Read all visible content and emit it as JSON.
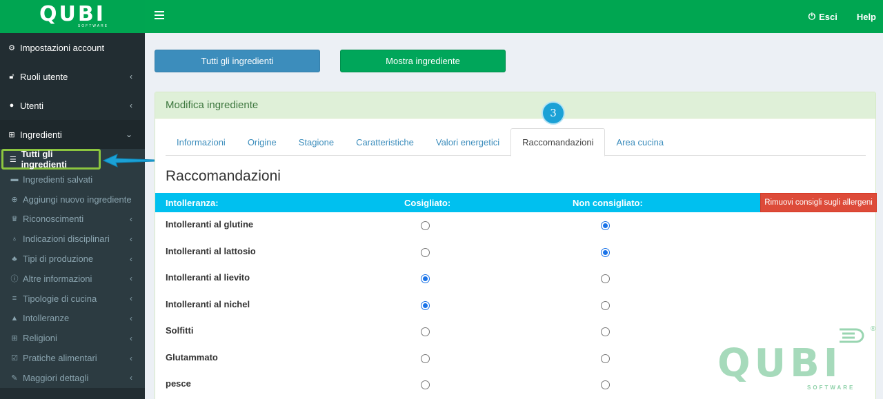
{
  "brand": {
    "logo": "QUBI",
    "logo_sub": "SOFTWARE",
    "watermark": "QUBI",
    "watermark_sub": "SOFTWARE",
    "registered": "®"
  },
  "topnav": {
    "logout": "Esci",
    "help": "Help"
  },
  "sidebar": {
    "main": [
      {
        "label": "Impostazioni account",
        "icon": "gear-icon"
      },
      {
        "label": "Ruoli utente",
        "icon": "unlock-icon"
      },
      {
        "label": "Utenti",
        "icon": "user-icon"
      },
      {
        "label": "Ingredienti",
        "icon": "sitemap-icon"
      }
    ],
    "sub": [
      {
        "label": "Tutti gli ingredienti",
        "icon": "list-icon"
      },
      {
        "label": "Ingredienti salvati",
        "icon": "archive-icon"
      },
      {
        "label": "Aggiungi nuovo ingrediente",
        "icon": "plus-circle-icon"
      },
      {
        "label": "Riconoscimenti",
        "icon": "trophy-icon"
      },
      {
        "label": "Indicazioni disciplinari",
        "icon": "lightbulb-icon"
      },
      {
        "label": "Tipi di produzione",
        "icon": "tree-icon"
      },
      {
        "label": "Altre informazioni",
        "icon": "info-icon"
      },
      {
        "label": "Tipologie di cucina",
        "icon": "align-icon"
      },
      {
        "label": "Intolleranze",
        "icon": "warning-icon"
      },
      {
        "label": "Religioni",
        "icon": "plus-square-icon"
      },
      {
        "label": "Pratiche alimentari",
        "icon": "check-square-icon"
      },
      {
        "label": "Maggiori dettagli",
        "icon": "wrench-icon"
      }
    ]
  },
  "buttons": {
    "all_ingredients": "Tutti gli ingredienti",
    "show_ingredient": "Mostra ingrediente"
  },
  "panel": {
    "title": "Modifica ingrediente",
    "step": "3",
    "tabs": [
      "Informazioni",
      "Origine",
      "Stagione",
      "Caratteristiche",
      "Valori energetici",
      "Raccomandazioni",
      "Area cucina"
    ],
    "active_tab": "Raccomandazioni",
    "section_title": "Raccomandazioni",
    "table": {
      "col_intolerance": "Intolleranza:",
      "col_recommended": "Cosigliato:",
      "col_not_recommended": "Non consigliato:",
      "remove_button": "Rimuovi consigli sugli allergeni",
      "rows": [
        {
          "label": "Intolleranti al glutine",
          "recommended": false,
          "not_recommended": true
        },
        {
          "label": "Intolleranti al lattosio",
          "recommended": false,
          "not_recommended": true
        },
        {
          "label": "Intolleranti al lievito",
          "recommended": true,
          "not_recommended": false
        },
        {
          "label": "Intolleranti al nichel",
          "recommended": true,
          "not_recommended": false
        },
        {
          "label": "Solfitti",
          "recommended": false,
          "not_recommended": false
        },
        {
          "label": "Glutammato",
          "recommended": false,
          "not_recommended": false
        },
        {
          "label": "pesce",
          "recommended": false,
          "not_recommended": false
        }
      ]
    }
  }
}
